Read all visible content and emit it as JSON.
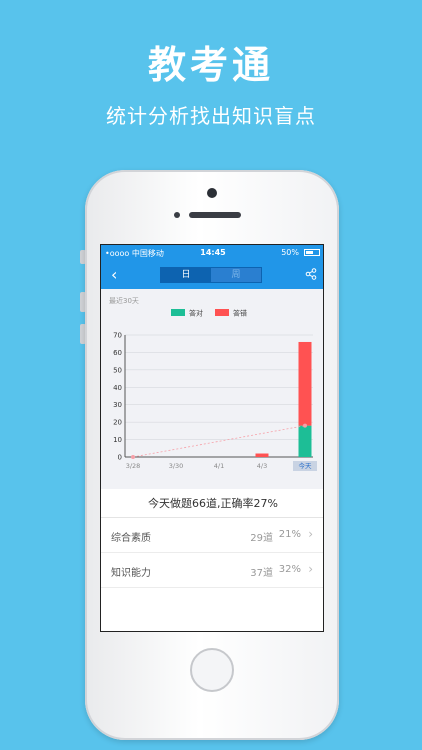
{
  "promo": {
    "title": "教考通",
    "subtitle": "统计分析找出知识盲点"
  },
  "status": {
    "carrier": "•oooo 中国移动",
    "time": "14:45",
    "battery": "50%"
  },
  "nav": {
    "back": "‹",
    "tabs": [
      {
        "label": "日",
        "active": true
      },
      {
        "label": "周",
        "active": false
      }
    ]
  },
  "chart_data": {
    "type": "bar",
    "caption": "最近30天",
    "legend": [
      {
        "name": "答对",
        "color": "#1dbe96"
      },
      {
        "name": "答错",
        "color": "#ff5252"
      }
    ],
    "yticks": [
      "0",
      "10",
      "20",
      "30",
      "40",
      "50",
      "60",
      "70"
    ],
    "xticks": [
      "3/28",
      "3/30",
      "4/1",
      "4/3",
      "今天"
    ],
    "ylim": [
      0,
      70
    ],
    "series": [
      {
        "name": "答对",
        "values": [
          0,
          0,
          0,
          0,
          18
        ]
      },
      {
        "name": "答错",
        "values": [
          0,
          0,
          0,
          2,
          48
        ]
      }
    ]
  },
  "summary": {
    "text": "今天做题66道,正确率27%"
  },
  "rows": [
    {
      "name": "综合素质",
      "count": "29道",
      "rate": "21%"
    },
    {
      "name": "知识能力",
      "count": "37道",
      "rate": "32%"
    }
  ]
}
